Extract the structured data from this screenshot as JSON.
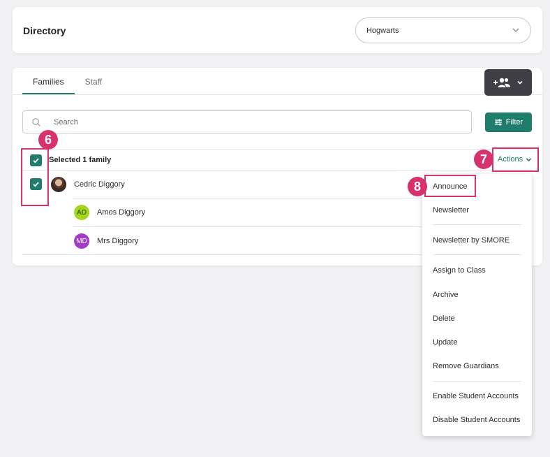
{
  "header": {
    "title": "Directory",
    "school_select": {
      "value": "Hogwarts"
    }
  },
  "tabs": [
    {
      "label": "Families",
      "active": true
    },
    {
      "label": "Staff",
      "active": false
    }
  ],
  "search": {
    "placeholder": "Search"
  },
  "filter": {
    "label": "Filter"
  },
  "selection": {
    "label": "Selected 1 family",
    "actions_label": "Actions"
  },
  "families": [
    {
      "name": "Cedric Diggory",
      "checked": true,
      "members": [
        {
          "initials": "AD",
          "name": "Amos Diggory",
          "color": "#a6d61a"
        },
        {
          "initials": "MD",
          "name": "Mrs Diggory",
          "color": "#a23dc9"
        }
      ]
    }
  ],
  "actions_menu": {
    "items": [
      "Announce",
      "Newsletter",
      "Newsletter by SMORE",
      "Assign to Class",
      "Archive",
      "Delete",
      "Update",
      "Remove Guardians",
      "Enable Student Accounts",
      "Disable Student Accounts"
    ]
  },
  "callouts": {
    "six": "6",
    "seven": "7",
    "eight": "8"
  },
  "colors": {
    "accent": "#1f7d6c",
    "callout": "#d8326e",
    "dark_button": "#3f3f46"
  }
}
